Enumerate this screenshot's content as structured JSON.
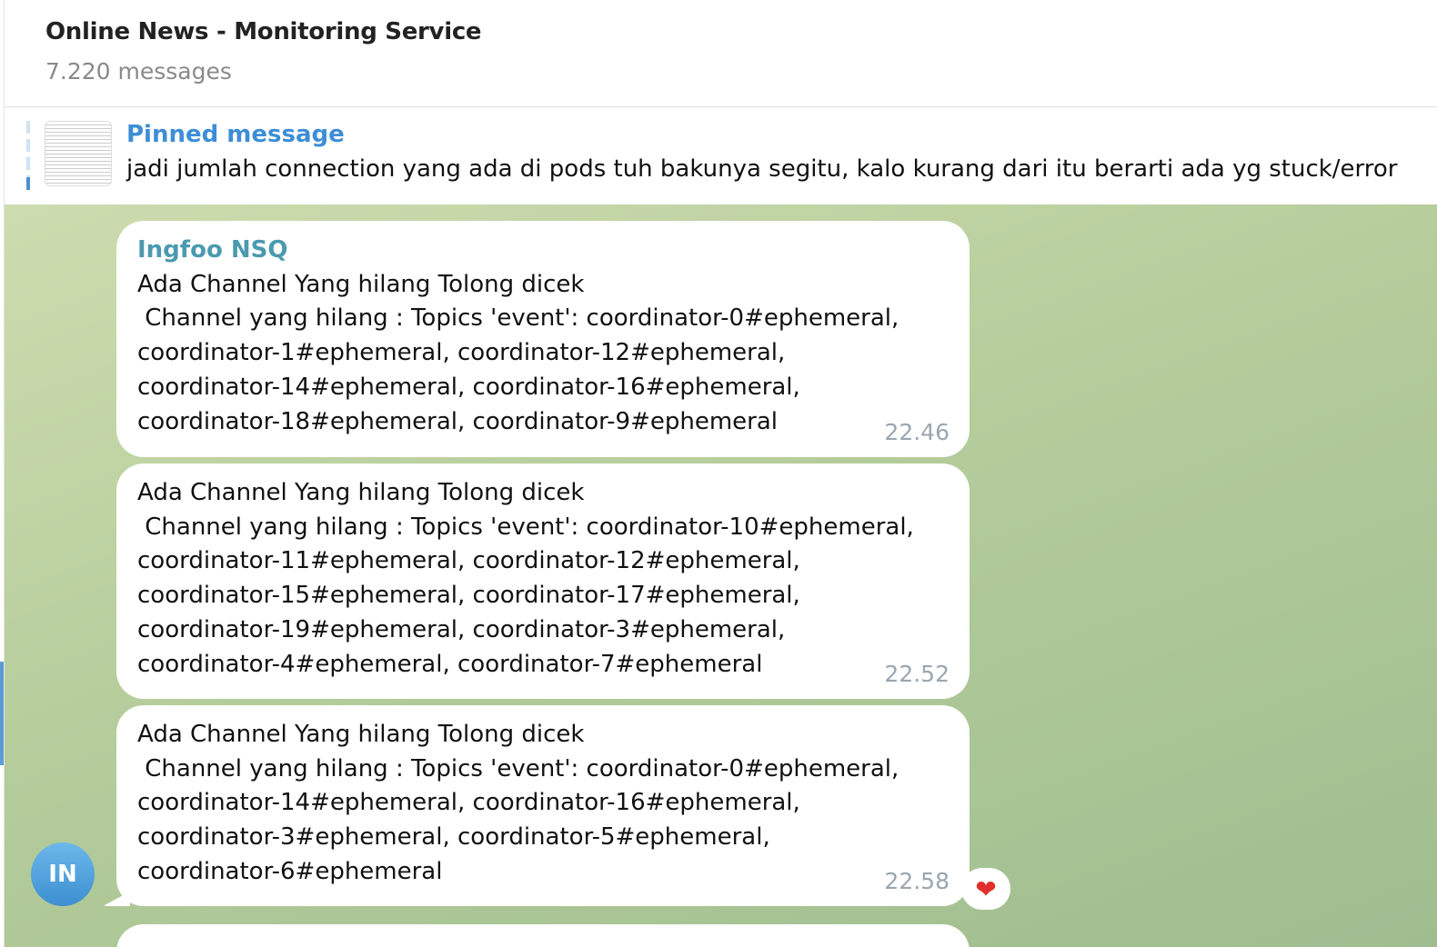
{
  "header": {
    "title": "Online News - Monitoring Service",
    "subtitle": "7.220 messages"
  },
  "pinned": {
    "label": "Pinned message",
    "text": "jadi jumlah connection yang ada di pods tuh bakunya segitu, kalo kurang dari itu berarti ada yg stuck/error"
  },
  "messages": [
    {
      "sender": "Ingfoo NSQ",
      "text": "Ada Channel Yang hilang Tolong dicek\n Channel yang hilang : Topics 'event': coordinator-0#ephemeral,\ncoordinator-1#ephemeral, coordinator-12#ephemeral,\ncoordinator-14#ephemeral, coordinator-16#ephemeral,\ncoordinator-18#ephemeral, coordinator-9#ephemeral",
      "time": "22.46"
    },
    {
      "text": "Ada Channel Yang hilang Tolong dicek\n Channel yang hilang : Topics 'event': coordinator-10#ephemeral,\ncoordinator-11#ephemeral, coordinator-12#ephemeral,\ncoordinator-15#ephemeral, coordinator-17#ephemeral,\ncoordinator-19#ephemeral, coordinator-3#ephemeral,\ncoordinator-4#ephemeral, coordinator-7#ephemeral",
      "time": "22.52"
    },
    {
      "text": "Ada Channel Yang hilang Tolong dicek\n Channel yang hilang : Topics 'event': coordinator-0#ephemeral,\ncoordinator-14#ephemeral, coordinator-16#ephemeral,\ncoordinator-3#ephemeral, coordinator-5#ephemeral,\ncoordinator-6#ephemeral",
      "time": "22.58",
      "reaction": "❤"
    }
  ],
  "avatar": {
    "initials": "IN"
  }
}
